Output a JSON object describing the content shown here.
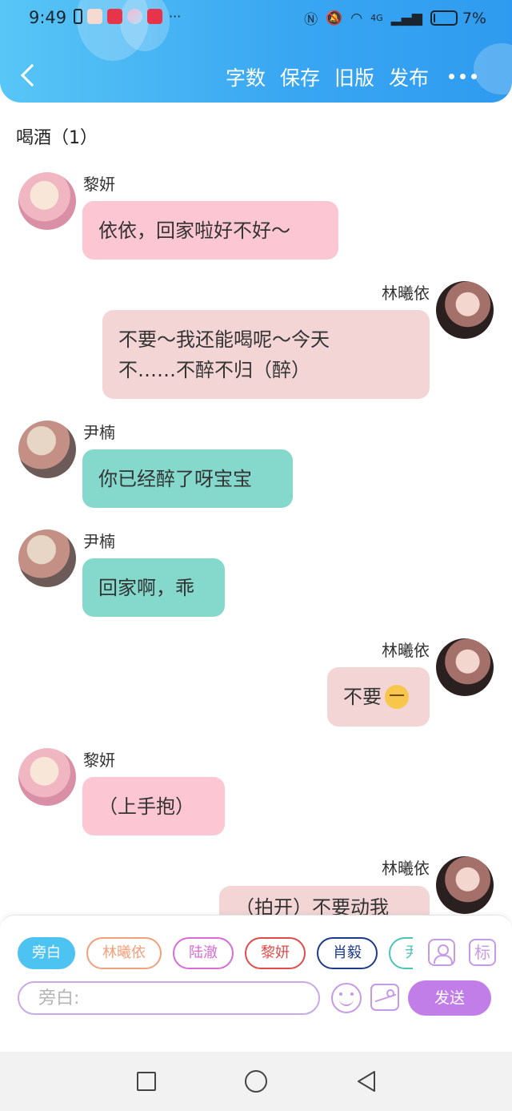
{
  "status_bar": {
    "time": "9:49",
    "network_label": "4G",
    "battery_pct": "7%",
    "battery_level": 0.07
  },
  "header": {
    "actions": [
      "字数",
      "保存",
      "旧版",
      "发布"
    ]
  },
  "chat": {
    "title": "喝酒（1）",
    "messages": [
      {
        "sender": "黎妍",
        "side": "left",
        "bubble_color": "#fcc7d2",
        "text": "依依，回家啦好不好～"
      },
      {
        "sender": "林曦依",
        "side": "right",
        "bubble_color": "#f3d5d6",
        "line1": "不要～我还能喝呢～今天",
        "line2": "不……不醉不归（醉）"
      },
      {
        "sender": "尹楠",
        "side": "left",
        "bubble_color": "#84d9cc",
        "text": "你已经醉了呀宝宝"
      },
      {
        "sender": "尹楠",
        "side": "left",
        "bubble_color": "#84d9cc",
        "text": "回家啊，乖"
      },
      {
        "sender": "林曦依",
        "side": "right",
        "bubble_color": "#f3d5d6",
        "text": "不要",
        "emoji": "sleepy-face-icon"
      },
      {
        "sender": "黎妍",
        "side": "left",
        "bubble_color": "#fcc7d2",
        "text": "（上手抱）"
      },
      {
        "sender": "林曦依",
        "side": "right",
        "bubble_color": "#f3d5d6",
        "text": "（拍开）不要动我"
      }
    ]
  },
  "composer": {
    "roles": [
      {
        "label": "旁白",
        "color": "#4cc3f1",
        "selected": true
      },
      {
        "label": "林曦依",
        "color": "#f0a07a",
        "selected": false
      },
      {
        "label": "陆澈",
        "color": "#d86bd8",
        "selected": false
      },
      {
        "label": "黎妍",
        "color": "#e24a4a",
        "selected": false
      },
      {
        "label": "肖毅",
        "color": "#1e3a8a",
        "selected": false
      },
      {
        "label": "尹楠",
        "color": "#4cc3b8",
        "selected": false
      }
    ],
    "mark_label": "标",
    "input_placeholder": "旁白:",
    "send_label": "发送"
  }
}
